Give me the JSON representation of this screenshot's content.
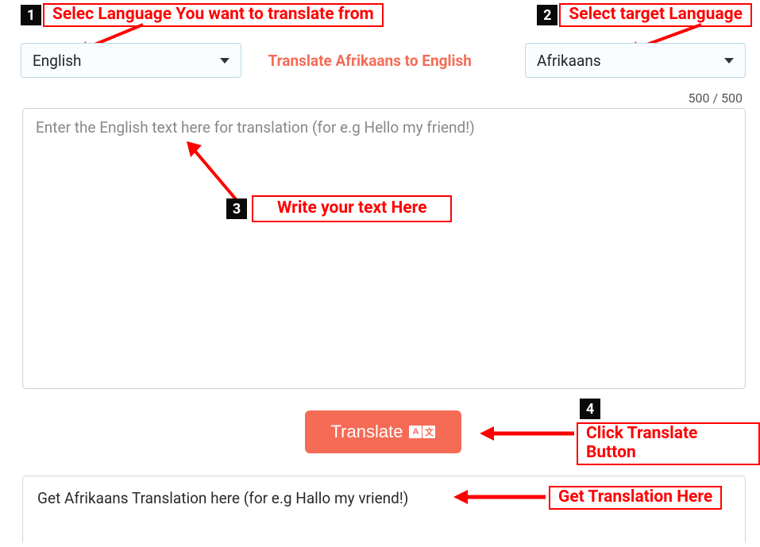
{
  "annotations": {
    "step1_num": "1",
    "step1_label": "Selec Language You want to  translate from",
    "step2_num": "2",
    "step2_label": "Select target Language",
    "step3_num": "3",
    "step3_label": "Write your text Here",
    "step4_num": "4",
    "step4_label": "Click Translate Button",
    "step5_label": "Get Translation Here"
  },
  "source_lang": "English",
  "target_lang": "Afrikaans",
  "title": "Translate Afrikaans to English",
  "char_count": "500 / 500",
  "input_placeholder": "Enter the English text here for translation (for e.g Hello my friend!)",
  "translate_label": "Translate",
  "translate_icon_a": "A",
  "translate_icon_b": "文",
  "output_placeholder": "Get Afrikaans Translation here (for e.g Hallo my vriend!)"
}
